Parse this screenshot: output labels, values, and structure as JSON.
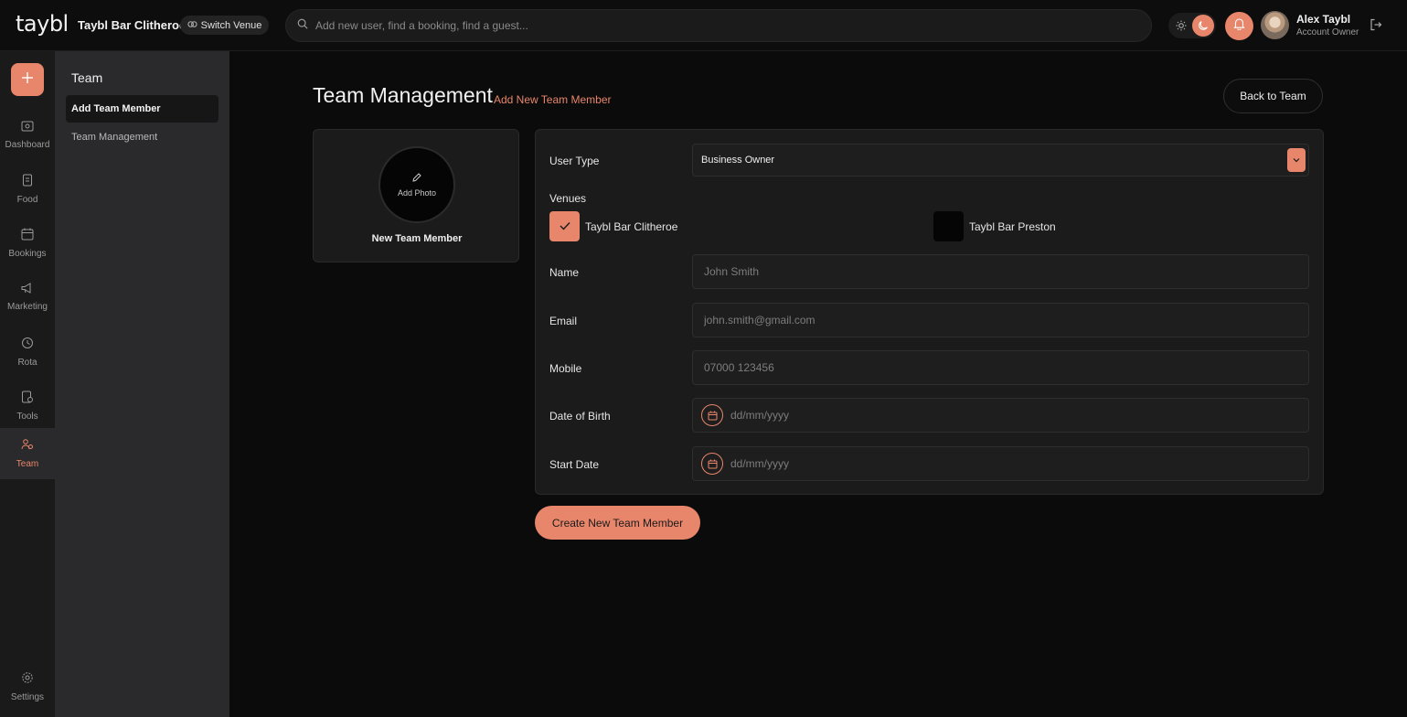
{
  "colors": {
    "accent": "#e8866b",
    "background": "#0b0b0b",
    "panel": "#1b1b1b",
    "subnav": "#2a2a2d"
  },
  "header": {
    "logo": "taybl",
    "venue_name": "Taybl Bar Clitheroe",
    "switch_venue_label": "Switch Venue",
    "search_placeholder": "Add new user, find a booking, find a guest...",
    "user_name": "Alex Taybl",
    "user_role": "Account Owner"
  },
  "rail": {
    "items": [
      {
        "label": "Dashboard",
        "icon": "dashboard-icon"
      },
      {
        "label": "Food",
        "icon": "food-icon"
      },
      {
        "label": "Bookings",
        "icon": "bookings-icon"
      },
      {
        "label": "Marketing",
        "icon": "megaphone-icon"
      },
      {
        "label": "Rota",
        "icon": "rota-icon"
      },
      {
        "label": "Tools",
        "icon": "tools-icon"
      },
      {
        "label": "Team",
        "icon": "team-icon",
        "active": true
      },
      {
        "label": "Settings",
        "icon": "gear-icon"
      }
    ]
  },
  "subnav": {
    "title": "Team",
    "items": [
      {
        "label": "Add Team Member",
        "active": true
      },
      {
        "label": "Team Management"
      }
    ]
  },
  "main": {
    "title": "Team Management",
    "subtitle": "Add New Team Member",
    "back_label": "Back to Team",
    "photo": {
      "add_label": "Add Photo",
      "member_label": "New Team Member"
    },
    "form": {
      "user_type_label": "User Type",
      "user_type_value": "Business Owner",
      "venues_label": "Venues",
      "venues": [
        {
          "name": "Taybl Bar Clitheroe",
          "checked": true
        },
        {
          "name": "Taybl Bar Preston",
          "checked": false
        }
      ],
      "name_label": "Name",
      "name_placeholder": "John Smith",
      "email_label": "Email",
      "email_placeholder": "john.smith@gmail.com",
      "mobile_label": "Mobile",
      "mobile_placeholder": "07000 123456",
      "dob_label": "Date of Birth",
      "dob_placeholder": "dd/mm/yyyy",
      "start_label": "Start Date",
      "start_placeholder": "dd/mm/yyyy"
    },
    "create_label": "Create New Team Member"
  }
}
